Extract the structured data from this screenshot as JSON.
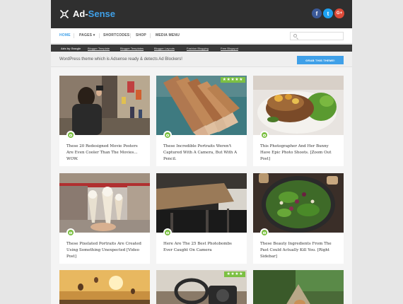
{
  "header": {
    "logo_main": "Ad-",
    "logo_accent": "Sense",
    "social": [
      {
        "name": "facebook-icon",
        "glyph": "f",
        "color": "#3b5998"
      },
      {
        "name": "twitter-icon",
        "glyph": "t",
        "color": "#1da1f2"
      },
      {
        "name": "google-plus-icon",
        "glyph": "G+",
        "color": "#dd4b39"
      }
    ]
  },
  "nav": {
    "items": [
      "HOME",
      "PAGES ▾",
      "SHORTCODES",
      "SHOP",
      "MEDIA MENU"
    ]
  },
  "subnav": {
    "items": [
      "Ads by Google",
      "Blogger Template",
      "Blogger Templates",
      "Blogger Layouts",
      "Fashion Blogging",
      "Free Blogspot"
    ]
  },
  "banner": {
    "text": "WordPress theme which is Adsense ready & detects Ad Blockers!",
    "button": "GRAB THIS THEME!"
  },
  "cards": [
    {
      "title": "These 20 Redesigned Movie Posters Are Even Cooler Than The Movies... WOW.",
      "stars": ""
    },
    {
      "title": "These Incredible Portraits Weren't Captured With A Camera, But With A Pencil.",
      "stars": "★★★★★"
    },
    {
      "title": "This Photographer And Her Bunny Have Epic Photo Shoots. [Zoom Out Post]",
      "stars": ""
    },
    {
      "title": "These Pixelated Portraits Are Created Using Something Unexpected [Video Post]",
      "stars": ""
    },
    {
      "title": "Here Are The 25 Best Photobombs Ever Caught On Camera",
      "stars": ""
    },
    {
      "title": "These Beauty Ingredients From The Past Could Actually Kill You. [Right Sidebar]",
      "stars": ""
    },
    {
      "title": "",
      "stars": ""
    },
    {
      "title": "",
      "stars": "★★★★"
    },
    {
      "title": "",
      "stars": ""
    }
  ]
}
